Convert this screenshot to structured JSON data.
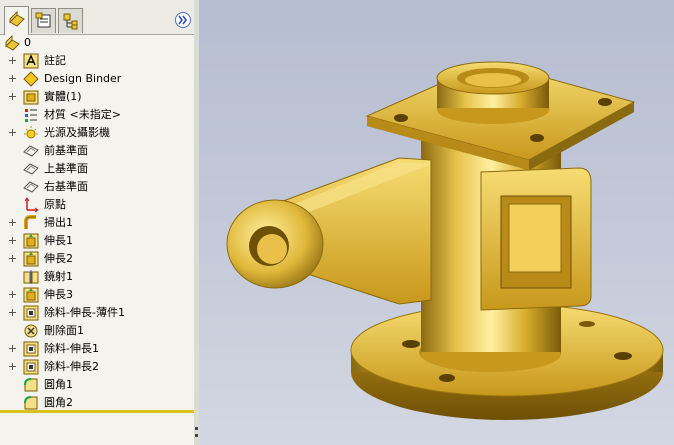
{
  "feature_manager": {
    "tabs": [
      {
        "name": "featuremanager-design-tree",
        "icon": "part-tree-icon"
      },
      {
        "name": "property-manager",
        "icon": "property-manager-icon"
      },
      {
        "name": "configuration-manager",
        "icon": "configuration-manager-icon"
      }
    ],
    "collapse_label": "»",
    "root_label": "0",
    "items": [
      {
        "label": "註記",
        "icon": "annotations-icon",
        "expandable": true
      },
      {
        "label": "Design Binder",
        "icon": "design-binder-icon",
        "expandable": true
      },
      {
        "label": "實體(1)",
        "icon": "solid-bodies-icon",
        "expandable": true
      },
      {
        "label": "材質 <未指定>",
        "icon": "material-icon",
        "expandable": false
      },
      {
        "label": "光源及攝影機",
        "icon": "lights-cameras-icon",
        "expandable": true
      },
      {
        "label": "前基準面",
        "icon": "plane-icon",
        "expandable": false
      },
      {
        "label": "上基準面",
        "icon": "plane-icon",
        "expandable": false
      },
      {
        "label": "右基準面",
        "icon": "plane-icon",
        "expandable": false
      },
      {
        "label": "原點",
        "icon": "origin-icon",
        "expandable": false
      },
      {
        "label": "掃出1",
        "icon": "sweep-icon",
        "expandable": true
      },
      {
        "label": "伸長1",
        "icon": "extrude-icon",
        "expandable": true
      },
      {
        "label": "伸長2",
        "icon": "extrude-icon",
        "expandable": true
      },
      {
        "label": "鏡射1",
        "icon": "mirror-icon",
        "expandable": false
      },
      {
        "label": "伸長3",
        "icon": "extrude-icon",
        "expandable": true
      },
      {
        "label": "除料-伸長-薄件1",
        "icon": "cut-extrude-icon",
        "expandable": true
      },
      {
        "label": "刪除面1",
        "icon": "delete-face-icon",
        "expandable": false
      },
      {
        "label": "除料-伸長1",
        "icon": "cut-extrude-icon",
        "expandable": true
      },
      {
        "label": "除料-伸長2",
        "icon": "cut-extrude-icon",
        "expandable": true
      },
      {
        "label": "圓角1",
        "icon": "fillet-icon",
        "expandable": false
      },
      {
        "label": "圓角2",
        "icon": "fillet-icon",
        "expandable": false
      }
    ]
  },
  "colors": {
    "part_gold": "#e0b83a",
    "part_dark": "#8a6a10",
    "viewport_top": "#b6bdd0",
    "viewport_bottom": "#d3d7e2",
    "divider": "#d9c219"
  }
}
